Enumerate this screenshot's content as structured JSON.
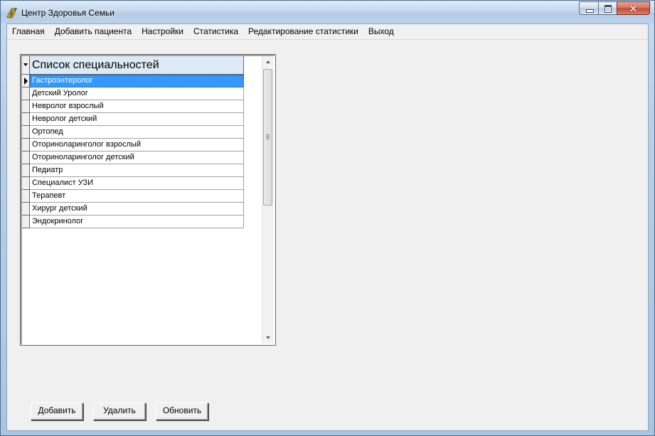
{
  "window": {
    "title": "Центр Здоровья Семьи",
    "close_glyph": "✕"
  },
  "menu": {
    "items": [
      "Главная",
      "Добавить пациента",
      "Настройки",
      "Статистика",
      "Редактирование статистики",
      "Выход"
    ]
  },
  "grid": {
    "column_header": "Список специальностей",
    "selected_index": 0,
    "rows": [
      "Гастроэнтеролог",
      "Детский Уролог",
      "Невролог взрослый",
      "Невролог детский",
      "Ортопед",
      "Оториноларинголог взрослый",
      "Оториноларинголог детский",
      "Педиатр",
      "Специалист УЗИ",
      "Терапевт",
      "Хирург детский",
      "Эндокринолог"
    ]
  },
  "buttons": {
    "add": "Добавить",
    "delete": "Удалить",
    "refresh": "Обновить"
  },
  "colors": {
    "selection": "#3399ff",
    "header_bg": "#dceaf6",
    "client_bg": "#f0f0f0"
  }
}
